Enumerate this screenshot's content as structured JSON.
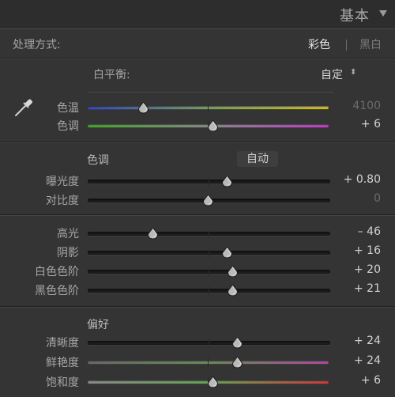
{
  "header": {
    "title": "基本"
  },
  "treatment": {
    "label": "处理方式:",
    "color": "彩色",
    "bw": "黑白"
  },
  "white_balance": {
    "label": "白平衡:",
    "value": "自定"
  },
  "wb_sliders": [
    {
      "label": "色温",
      "value": "4100",
      "pos": 0.23,
      "style": "temp",
      "dim": true
    },
    {
      "label": "色调",
      "value": "+ 6",
      "pos": 0.52,
      "style": "tint",
      "dim": false
    }
  ],
  "tone": {
    "section": "色调",
    "auto": "自动"
  },
  "tone_sliders_a": [
    {
      "label": "曝光度",
      "value": "+ 0.80",
      "pos": 0.58,
      "dim": false
    },
    {
      "label": "对比度",
      "value": "0",
      "pos": 0.5,
      "dim": true
    }
  ],
  "tone_sliders_b": [
    {
      "label": "高光",
      "value": "– 46",
      "pos": 0.27,
      "dim": false
    },
    {
      "label": "阴影",
      "value": "+ 16",
      "pos": 0.58,
      "dim": false
    },
    {
      "label": "白色色阶",
      "value": "+ 20",
      "pos": 0.6,
      "dim": false
    },
    {
      "label": "黑色色阶",
      "value": "+ 21",
      "pos": 0.6,
      "dim": false
    }
  ],
  "presence": {
    "section": "偏好"
  },
  "presence_sliders": [
    {
      "label": "清晰度",
      "value": "+ 24",
      "pos": 0.62,
      "style": "plain",
      "dim": false
    },
    {
      "label": "鲜艳度",
      "value": "+ 24",
      "pos": 0.62,
      "style": "vibrance",
      "dim": false
    },
    {
      "label": "饱和度",
      "value": "+ 6",
      "pos": 0.52,
      "style": "saturation",
      "dim": false
    }
  ],
  "colors": {
    "temp_gradient": [
      "#3a4aa0",
      "#7d9a6a",
      "#c9b84a"
    ],
    "tint_gradient": [
      "#4f9e3c",
      "#8a8a8a",
      "#b04ab8"
    ],
    "vibrance_gradient": [
      "#6a6a6a",
      "#6b8a5a",
      "#b04aa0"
    ],
    "saturation_gradient": [
      "#8a8a8a",
      "#6aa05a",
      "#c04040"
    ]
  },
  "icons": {
    "picker": "eyedropper-icon",
    "collapse": "triangle-down-icon",
    "stepper": "up-down-arrows-icon"
  }
}
